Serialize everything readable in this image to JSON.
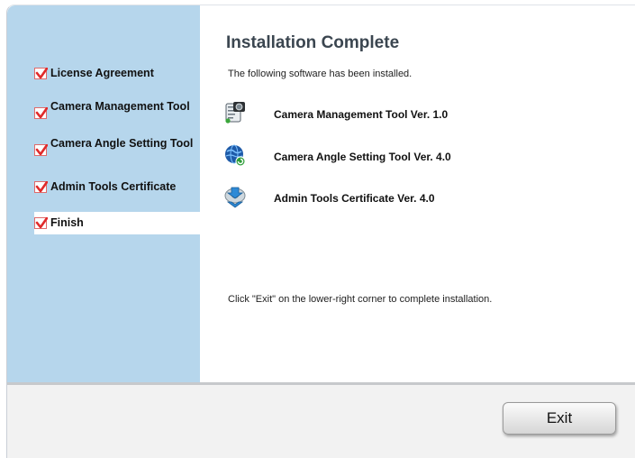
{
  "sidebar": {
    "steps": [
      {
        "label": "License Agreement",
        "checked": true
      },
      {
        "label": "Camera Management Tool",
        "checked": true
      },
      {
        "label": "Camera Angle Setting Tool",
        "checked": true
      },
      {
        "label": "Admin Tools Certificate",
        "checked": true
      },
      {
        "label": "Finish",
        "checked": true,
        "active": true
      }
    ]
  },
  "main": {
    "title": "Installation Complete",
    "intro": "The following software has been installed.",
    "software": [
      {
        "label": "Camera Management Tool Ver. 1.0",
        "icon": "camera-management-icon"
      },
      {
        "label": "Camera Angle Setting Tool Ver. 4.0",
        "icon": "globe-icon"
      },
      {
        "label": "Admin Tools Certificate Ver. 4.0",
        "icon": "install-disc-icon"
      }
    ],
    "footer_note": "Click \"Exit\" on the lower-right corner to complete installation."
  },
  "footer": {
    "exit_label": "Exit"
  },
  "colors": {
    "sidebar_bg": "#b6d6ec",
    "check_red": "#e02a2a"
  }
}
